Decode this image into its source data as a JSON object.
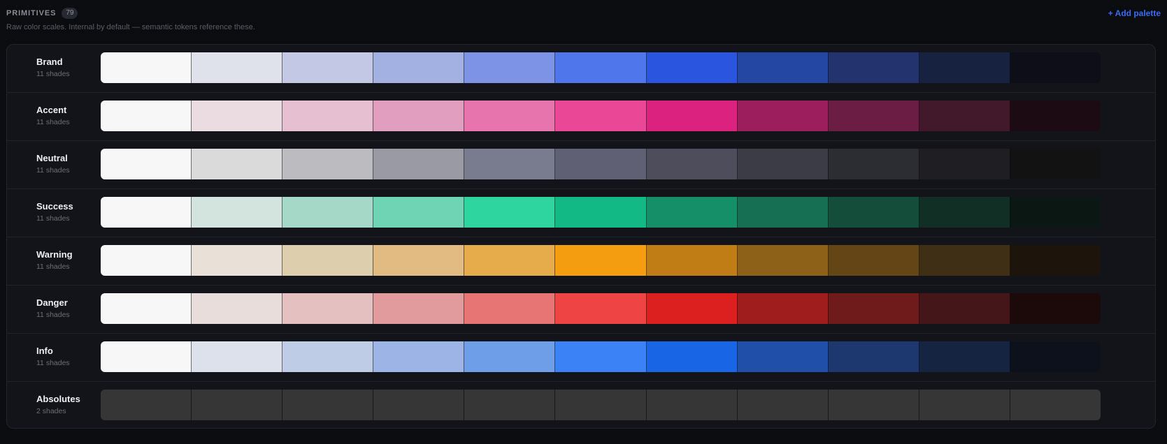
{
  "header": {
    "title": "PRIMITIVES",
    "count": "79",
    "subtitle": "Raw color scales. Internal by default — semantic tokens reference these.",
    "add_label": "+ Add palette"
  },
  "palettes": [
    {
      "name": "Brand",
      "shades_label": "11 shades",
      "swatches": [
        "#f7f7f7",
        "#dfe1eb",
        "#c3c9e5",
        "#a2b1e1",
        "#7d94e6",
        "#5076ec",
        "#2a56df",
        "#2547a4",
        "#22336e",
        "#172140",
        "#0d0e17"
      ]
    },
    {
      "name": "Accent",
      "shades_label": "11 shades",
      "swatches": [
        "#f7f7f7",
        "#ebdce2",
        "#e6bfd0",
        "#e19ebf",
        "#e874ad",
        "#ea4897",
        "#db227e",
        "#9d1e5d",
        "#6c1d43",
        "#42182b",
        "#1c0b12"
      ]
    },
    {
      "name": "Neutral",
      "shades_label": "11 shades",
      "swatches": [
        "#f7f7f7",
        "#dadadb",
        "#bbbbc0",
        "#9a9aa5",
        "#797b8e",
        "#5f6074",
        "#4d4d5c",
        "#3b3c45",
        "#2c2d33",
        "#1f1f23",
        "#121213"
      ]
    },
    {
      "name": "Success",
      "shades_label": "11 shades",
      "swatches": [
        "#f7f7f7",
        "#d3e4de",
        "#a6d8c7",
        "#6ed4b3",
        "#2ed59f",
        "#12b985",
        "#158f68",
        "#166f52",
        "#144e3a",
        "#112f24",
        "#0b1712"
      ]
    },
    {
      "name": "Warning",
      "shades_label": "11 shades",
      "swatches": [
        "#f7f7f7",
        "#e9e0d7",
        "#ddcfae",
        "#e1bb82",
        "#e6ac4c",
        "#f59d10",
        "#c07d15",
        "#8e6118",
        "#634516",
        "#3f2f14",
        "#1d150b"
      ]
    },
    {
      "name": "Danger",
      "shades_label": "11 shades",
      "swatches": [
        "#f7f7f7",
        "#e9dddb",
        "#e4c0c0",
        "#e29b9d",
        "#e67573",
        "#ef4444",
        "#dc2020",
        "#a01d1d",
        "#6f1b1b",
        "#44161a",
        "#1c0909"
      ]
    },
    {
      "name": "Info",
      "shades_label": "11 shades",
      "swatches": [
        "#f7f7f7",
        "#dde1eb",
        "#bfcce5",
        "#9db5e6",
        "#6f9ee9",
        "#3b82f6",
        "#1866e6",
        "#1f4fa8",
        "#1d386e",
        "#142441",
        "#0c111c"
      ]
    },
    {
      "name": "Absolutes",
      "shades_label": "2 shades",
      "swatches": [
        "#363636",
        "#363636",
        "#363636",
        "#363636",
        "#363636",
        "#363636",
        "#363636",
        "#363636",
        "#363636",
        "#363636",
        "#363636"
      ]
    }
  ]
}
